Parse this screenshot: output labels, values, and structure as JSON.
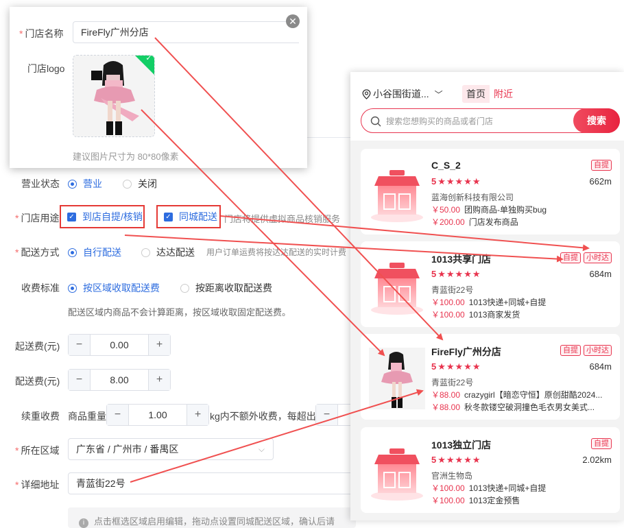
{
  "popup": {
    "name_label": "门店名称",
    "name_value": "FireFly广州分店",
    "logo_label": "门店logo",
    "logo_hint": "建议图片尺寸为 80*80像素"
  },
  "form": {
    "status_label": "营业状态",
    "status_open": "营业",
    "status_closed": "关闭",
    "usage_label": "门店用途",
    "usage_pickup": "到店自提/核销",
    "usage_delivery": "同城配送",
    "usage_hint": "门店将提供虚拟商品核销服务",
    "delivery_label": "配送方式",
    "delivery_self": "自行配送",
    "delivery_dada": "达达配送",
    "delivery_hint": "用户订单运费将按达达配送的实时计费",
    "fee_std_label": "收费标准",
    "fee_by_area": "按区域收取配送费",
    "fee_by_distance": "按距离收取配送费",
    "fee_note": "配送区域内商品不会计算距离，按区域收取固定配送费。",
    "min_fee_label": "起送费(元)",
    "min_fee_value": "0.00",
    "delivery_fee_label": "配送费(元)",
    "delivery_fee_value": "8.00",
    "extra_label": "续重收费",
    "extra_prefix": "商品重量",
    "extra_value": "1.00",
    "extra_suffix": "kg内不额外收费，每超出",
    "region_label": "所在区域",
    "region_value": "广东省 / 广州市 / 番禺区",
    "address_label": "详细地址",
    "address_value": "青蓝街22号",
    "map_tip": "点击框选区域启用编辑，拖动点设置同城配送区域，确认后请"
  },
  "phone": {
    "location": "小谷围街道...",
    "tab_home": "首页",
    "tab_nearby": "附近",
    "search_placeholder": "搜索您想购买的商品或者门店",
    "search_button": "搜索",
    "stores": [
      {
        "name": "C_S_2",
        "rating": "5",
        "distance": "662m",
        "tags": [
          "自提"
        ],
        "address": "蓝海创新科技有限公司",
        "products": [
          {
            "price": "￥50.00",
            "title": "团购商品-单独购买bug"
          },
          {
            "price": "￥200.00",
            "title": "门店发布商品"
          }
        ]
      },
      {
        "name": "1013共享门店",
        "rating": "5",
        "distance": "684m",
        "tags": [
          "自提",
          "小时达"
        ],
        "address": "青蓝街22号",
        "products": [
          {
            "price": "￥100.00",
            "title": "1013快递+同城+自提"
          },
          {
            "price": "￥100.00",
            "title": "1013商家发货"
          }
        ]
      },
      {
        "name": "FireFly广州分店",
        "rating": "5",
        "distance": "684m",
        "tags": [
          "自提",
          "小时达"
        ],
        "address": "青蓝街22号",
        "products": [
          {
            "price": "￥88.00",
            "title": "crazygirl【暗恋守恒】原创甜酷2024..."
          },
          {
            "price": "￥88.00",
            "title": "秋冬款镂空破洞撞色毛衣男女美式..."
          }
        ]
      },
      {
        "name": "1013独立门店",
        "rating": "5",
        "distance": "2.02km",
        "tags": [
          "自提"
        ],
        "address": "官洲生物岛",
        "products": [
          {
            "price": "￥100.00",
            "title": "1013快递+同城+自提"
          },
          {
            "price": "￥100.00",
            "title": "1013定金预售"
          }
        ]
      }
    ]
  },
  "colors": {
    "accent": "#2d6cdf",
    "brand_red": "#e8344e",
    "annotation_red": "#f05050"
  }
}
